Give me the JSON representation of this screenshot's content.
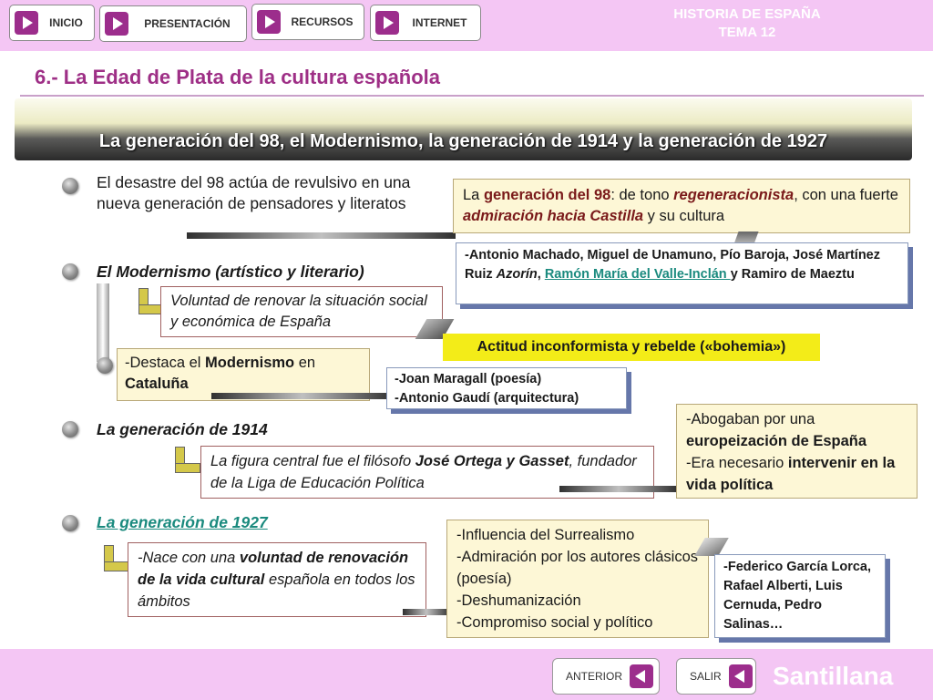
{
  "nav": {
    "inicio": "INICIO",
    "presentacion": "PRESENTACIÓN",
    "recursos": "RECURSOS",
    "internet": "INTERNET"
  },
  "brand": {
    "line1": "HISTORIA DE ESPAÑA",
    "line2": "TEMA 12"
  },
  "title": "6.- La Edad de Plata de la cultura española",
  "banner": "La generación del 98, el Modernismo, la generación de 1914 y la generación de 1927",
  "s98": {
    "text": "El desastre del 98 actúa de revulsivo en una nueva generación de pensadores y literatos",
    "box": {
      "p1": "La ",
      "p2": "generación del 98",
      "p3": ": de tono ",
      "p4": "regeneracionista",
      "p5": ", con una fuerte ",
      "p6": "admiración hacia Castilla",
      "p7": " y su cultura"
    },
    "names": {
      "p1": "-Antonio Machado, Miguel de Unamuno, Pío Baroja, José Martínez Ruiz ",
      "p2": "Azorín",
      "p3": ", ",
      "link": "Ramón María del Valle-Inclán ",
      "p4": "y Ramiro de Maeztu"
    }
  },
  "modernismo": {
    "heading": "El Modernismo (artístico y literario)",
    "box1": "Voluntad de renovar la situación social y económica de España",
    "attitude": "Actitud inconformista y rebelde («bohemia»)",
    "box2": {
      "p1": "-Destaca el ",
      "p2": "Modernismo",
      "p3": " en ",
      "p4": "Cataluña"
    },
    "names": {
      "l1": "-Joan Maragall (poesía)",
      "l2": "-Antonio Gaudí (arquitectura)"
    }
  },
  "g1914": {
    "heading": "La generación de 1914",
    "box": {
      "p1": "La figura central fue el filósofo ",
      "p2": "José Ortega y Gasset",
      "p3": ", fundador de la Liga de Educación Política"
    },
    "side": {
      "p1": "-Abogaban por una ",
      "p2": "europeización de España",
      "p3": "-Era necesario ",
      "p4": "intervenir en la vida política"
    }
  },
  "g1927": {
    "heading": "La generación de 1927",
    "box": {
      "p1": "-Nace con una ",
      "p2": "voluntad de renovación de la vida cultural",
      "p3": " española en todos los ámbitos"
    },
    "list": [
      "-Influencia del Surrealismo",
      "-Admiración por los autores clásicos (poesía)",
      "-Deshumanización",
      "-Compromiso social y político"
    ],
    "names": {
      "p1": "-",
      "p2": "Federico García Lorca, Rafael Alberti, Luis Cernuda, Pedro Salinas…"
    }
  },
  "footer": {
    "anterior": "ANTERIOR",
    "salir": "SALIR",
    "publisher": "Santillana"
  }
}
